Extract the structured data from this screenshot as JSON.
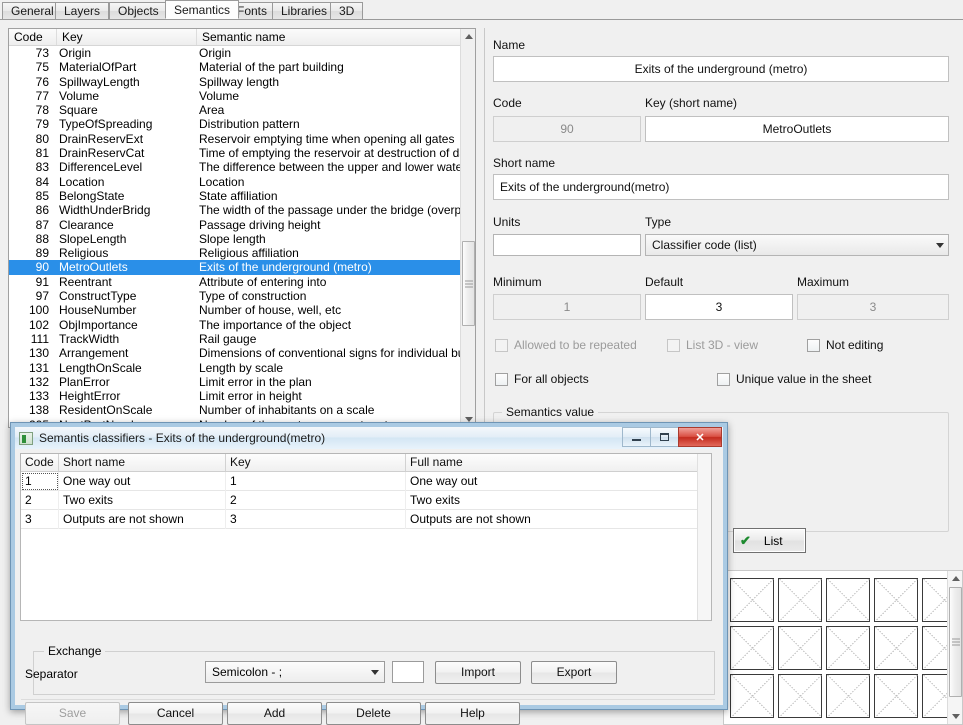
{
  "tabs": [
    {
      "label": "General",
      "active": false
    },
    {
      "label": "Layers",
      "active": false
    },
    {
      "label": "Objects",
      "active": false
    },
    {
      "label": "Semantics",
      "active": true
    },
    {
      "label": "Fonts",
      "active": false
    },
    {
      "label": "Libraries",
      "active": false
    },
    {
      "label": "3D",
      "active": false
    }
  ],
  "semantics_list": {
    "columns": [
      "Code",
      "Key",
      "Semantic name"
    ],
    "rows": [
      {
        "code": "73",
        "key": "Origin",
        "name": "Origin",
        "selected": false
      },
      {
        "code": "75",
        "key": "MaterialOfPart",
        "name": "Material of the part building",
        "selected": false
      },
      {
        "code": "76",
        "key": "SpillwayLength",
        "name": "Spillway length",
        "selected": false
      },
      {
        "code": "77",
        "key": "Volume",
        "name": "Volume",
        "selected": false
      },
      {
        "code": "78",
        "key": "Square",
        "name": "Area",
        "selected": false
      },
      {
        "code": "79",
        "key": "TypeOfSpreading",
        "name": "Distribution pattern",
        "selected": false
      },
      {
        "code": "80",
        "key": "DrainReservExt",
        "name": "Reservoir emptying time when opening all gates",
        "selected": false
      },
      {
        "code": "81",
        "key": "DrainReservCat",
        "name": "Time of emptying the reservoir at destruction of da",
        "selected": false
      },
      {
        "code": "83",
        "key": "DifferenceLevel",
        "name": "The difference between the upper and lower water",
        "selected": false
      },
      {
        "code": "84",
        "key": "Location",
        "name": "Location",
        "selected": false
      },
      {
        "code": "85",
        "key": "BelongState",
        "name": "State affiliation",
        "selected": false
      },
      {
        "code": "86",
        "key": "WidthUnderBridg",
        "name": "The width of the passage under the bridge (overpa",
        "selected": false
      },
      {
        "code": "87",
        "key": "Clearance",
        "name": "Passage driving height",
        "selected": false
      },
      {
        "code": "88",
        "key": "SlopeLength",
        "name": "Slope length",
        "selected": false
      },
      {
        "code": "89",
        "key": "Religious",
        "name": "Religious affiliation",
        "selected": false
      },
      {
        "code": "90",
        "key": "MetroOutlets",
        "name": "Exits of the underground (metro)",
        "selected": true
      },
      {
        "code": "91",
        "key": "Reentrant",
        "name": "Attribute of entering into",
        "selected": false
      },
      {
        "code": "97",
        "key": "ConstructType",
        "name": "Type of construction",
        "selected": false
      },
      {
        "code": "100",
        "key": "HouseNumber",
        "name": "Number of house, well, etc",
        "selected": false
      },
      {
        "code": "102",
        "key": "ObjImportance",
        "name": "The importance of the object",
        "selected": false
      },
      {
        "code": "111",
        "key": "TrackWidth",
        "name": "Rail gauge",
        "selected": false
      },
      {
        "code": "130",
        "key": "Arrangement",
        "name": "Dimensions of conventional signs for individual bu",
        "selected": false
      },
      {
        "code": "131",
        "key": "LengthOnScale",
        "name": "Length by scale",
        "selected": false
      },
      {
        "code": "132",
        "key": "PlanError",
        "name": "Limit error in the plan",
        "selected": false
      },
      {
        "code": "133",
        "key": "HeightError",
        "name": "Limit error in height",
        "selected": false
      },
      {
        "code": "138",
        "key": "ResidentOnScale",
        "name": "Number of inhabitants on a scale",
        "selected": false
      },
      {
        "code": "205",
        "key": "NextPartNumber",
        "name": "Number of the next component part",
        "selected": false
      }
    ]
  },
  "properties": {
    "name_label": "Name",
    "name_value": "Exits of the underground (metro)",
    "code_label": "Code",
    "code_value": "90",
    "key_label": "Key (short name)",
    "key_value": "MetroOutlets",
    "shortname_label": "Short name",
    "shortname_value": "Exits of the underground(metro)",
    "units_label": "Units",
    "units_value": "",
    "type_label": "Type",
    "type_value": "Classifier code (list)",
    "minimum_label": "Minimum",
    "minimum_value": "1",
    "default_label": "Default",
    "default_value": "3",
    "maximum_label": "Maximum",
    "maximum_value": "3",
    "chk_repeated": "Allowed to be repeated",
    "chk_list3d": "List 3D - view",
    "chk_notediting": "Not editing",
    "chk_forall": "For all objects",
    "chk_unique": "Unique value in the sheet",
    "semantics_value_group": "Semantics value",
    "list_button": "List"
  },
  "dialog": {
    "title": "Semantis classifiers - Exits of the underground(metro)",
    "columns": [
      "Code",
      "Short name",
      "Key",
      "Full name"
    ],
    "rows": [
      {
        "code": "1",
        "short_name": "One way out",
        "key": "1",
        "full_name": "One way out"
      },
      {
        "code": "2",
        "short_name": "Two exits",
        "key": "2",
        "full_name": "Two exits"
      },
      {
        "code": "3",
        "short_name": "Outputs are not shown",
        "key": "3",
        "full_name": "Outputs are not shown"
      }
    ],
    "exchange_label": "Exchange",
    "separator_label": "Separator",
    "separator_value": "Semicolon - ;",
    "separator_custom": "",
    "import_button": "Import",
    "export_button": "Export",
    "save_button": "Save",
    "cancel_button": "Cancel",
    "add_button": "Add",
    "delete_button": "Delete",
    "help_button": "Help",
    "minimize_icon": "minimize-icon",
    "maximize_icon": "maximize-icon",
    "close_icon": "close-icon",
    "close_glyph": "✕"
  },
  "colors": {
    "selection_blue": "#2a8fe8",
    "window_bg": "#f0f0f0",
    "close_red": "#c32b1e",
    "check_green": "#1d8a2f"
  }
}
